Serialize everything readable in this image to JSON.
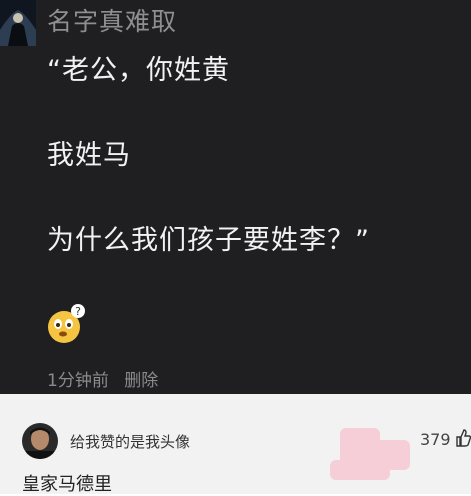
{
  "post": {
    "username": "名字真难取",
    "lines": [
      "“老公，你姓黄",
      "我姓马",
      "为什么我们孩子要姓李？”"
    ],
    "time": "1分钟前",
    "delete_label": "删除",
    "emoji": "thinking-face-emoji"
  },
  "comment": {
    "username": "给我赞的是我头像",
    "likes": "379",
    "text": "皇家马德里",
    "like_icon": "thumb-up-icon"
  },
  "colors": {
    "dark_bg": "#1f1f21",
    "light_bg": "#f2f2f2",
    "username_gray": "#8e8e93"
  }
}
